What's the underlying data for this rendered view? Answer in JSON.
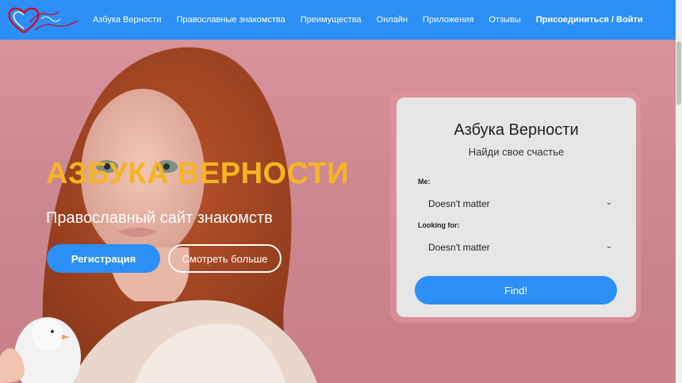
{
  "nav": {
    "logo_alt": "Азбука Верности",
    "links": [
      {
        "label": "Азбука Верности"
      },
      {
        "label": "Православные знакомства"
      },
      {
        "label": "Преимущества"
      },
      {
        "label": "Онлайн"
      },
      {
        "label": "Приложения"
      },
      {
        "label": "Отзывы"
      },
      {
        "label": "Присоединиться / Войти"
      }
    ]
  },
  "hero": {
    "title": "АЗБУКА ВЕРНОСТИ",
    "subtitle": "Православный сайт знакомств",
    "register_label": "Регистрация",
    "more_label": "Смотреть больше"
  },
  "card": {
    "title": "Азбука Верности",
    "subtitle": "Найди свое счастье",
    "me_label": "Me:",
    "me_value": "Doesn't matter",
    "looking_label": "Looking for:",
    "looking_value": "Doesn't matter",
    "find_label": "Find!"
  },
  "colors": {
    "accent": "#2b8ff7",
    "title_yellow": "#f5b523",
    "hero_bg": "#d68f97"
  }
}
